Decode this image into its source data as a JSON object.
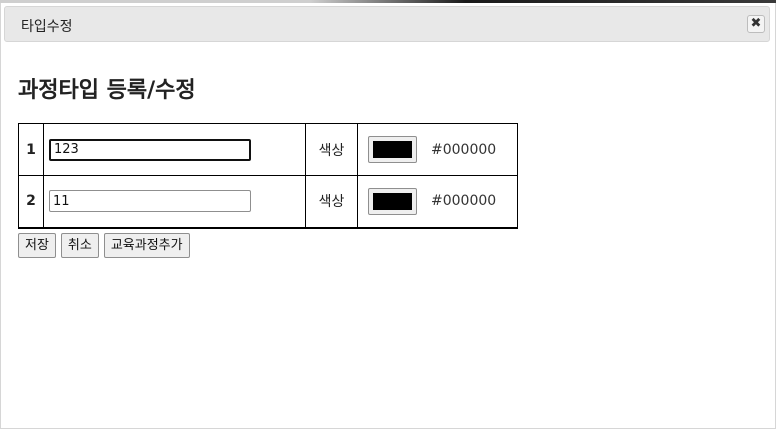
{
  "dialog": {
    "title": "타입수정",
    "close_icon": "close-icon"
  },
  "heading": "과정타입 등록/수정",
  "rows": [
    {
      "no": "1",
      "name": "123",
      "color_label": "색상",
      "color": "#000000",
      "color_text": "#000000"
    },
    {
      "no": "2",
      "name": "11",
      "color_label": "색상",
      "color": "#000000",
      "color_text": "#000000"
    }
  ],
  "buttons": {
    "save": "저장",
    "cancel": "취소",
    "add_course": "교육과정추가"
  }
}
